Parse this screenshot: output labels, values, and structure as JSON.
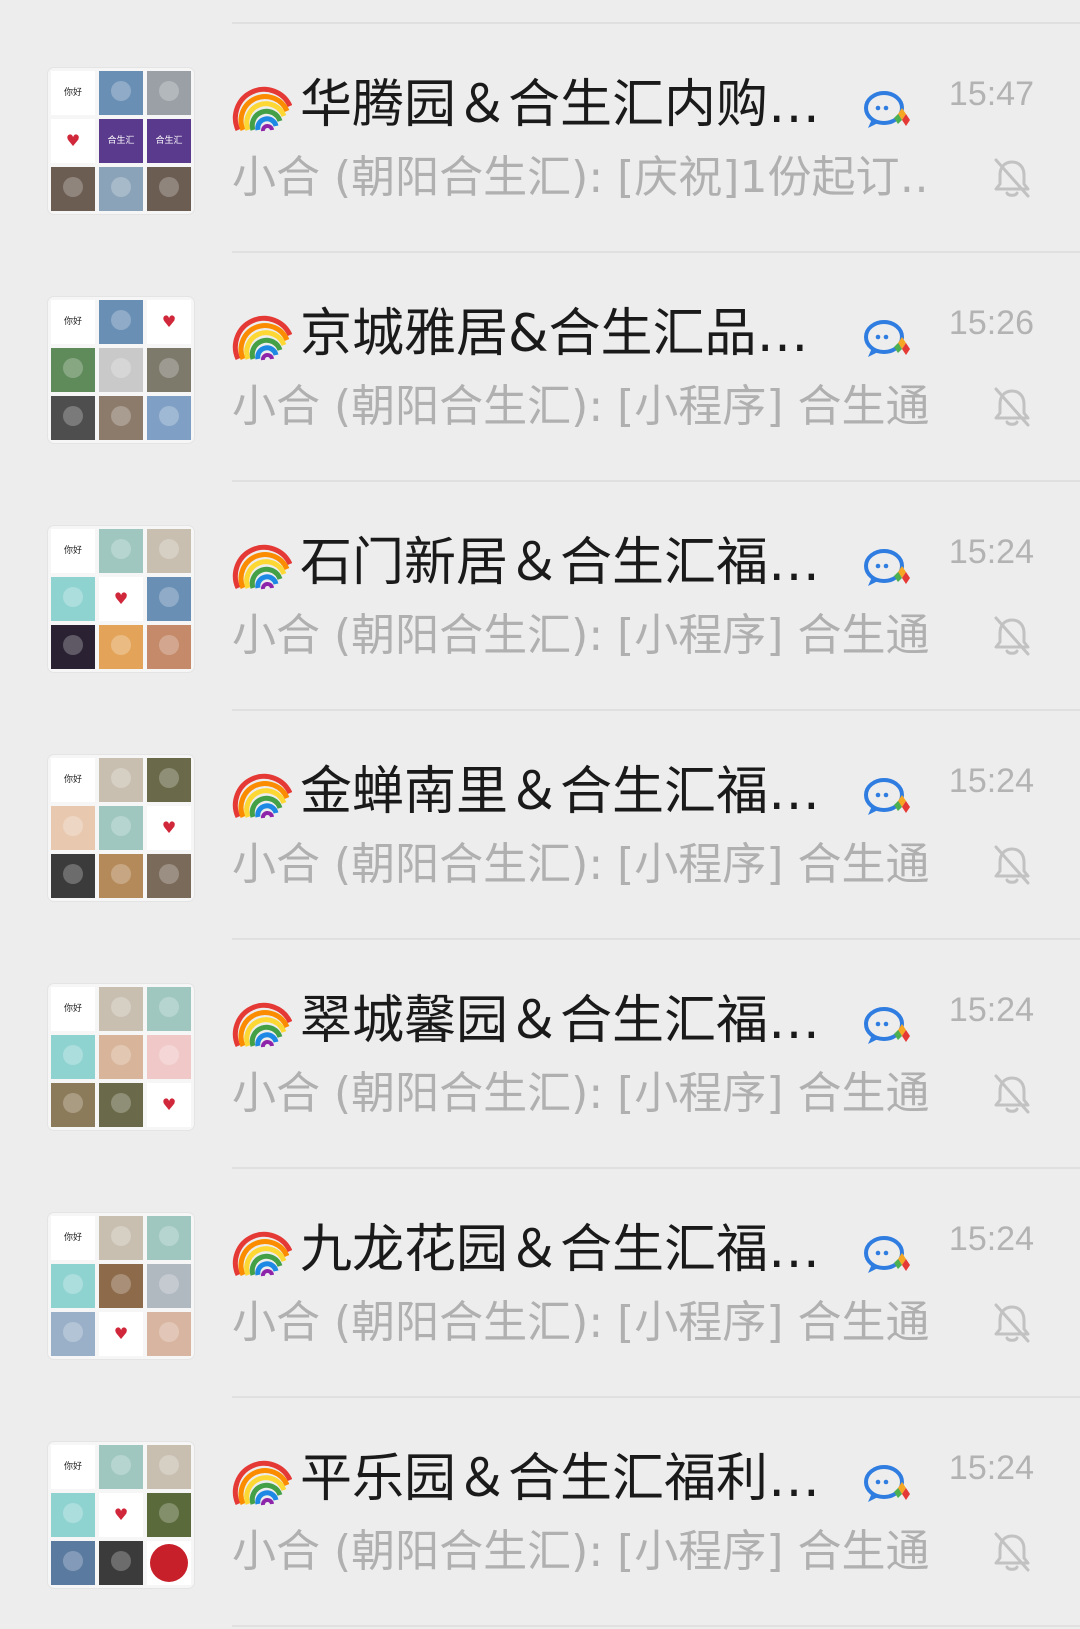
{
  "chats": [
    {
      "title": "华腾园＆合生汇内购…",
      "time": "15:47",
      "preview": "小合 (朝阳合生汇): [庆祝]1份起订…",
      "avatar": [
        "text:你好\n小合",
        "photo:#6a8fb5",
        "photo:#9aa0a6",
        "heart",
        "brand:合生汇",
        "brand:合生汇",
        "photo:#6b5d52",
        "photo:#8aa3b8",
        "photo:#6b5d52"
      ]
    },
    {
      "title": "京城雅居&合生汇品…",
      "time": "15:26",
      "preview": "小合 (朝阳合生汇): [小程序] 合生通",
      "avatar": [
        "text:你好\n小合",
        "photo:#6a8fb5",
        "heart",
        "photo:#5f8a5a",
        "photo:#c9c9c9",
        "photo:#7d7a6c",
        "photo:#4e4e4e",
        "photo:#8c7b6b",
        "photo:#7fa0c4"
      ]
    },
    {
      "title": "石门新居＆合生汇福…",
      "time": "15:24",
      "preview": "小合 (朝阳合生汇): [小程序] 合生通",
      "avatar": [
        "text:你好\n小合",
        "photo:#9fc7c0",
        "photo:#c8bfb0",
        "photo:#8fd3d1",
        "heart",
        "photo:#6a8fb5",
        "photo:#2a2233",
        "photo:#e3a45a",
        "photo:#c48a6a"
      ]
    },
    {
      "title": "金蝉南里＆合生汇福…",
      "time": "15:24",
      "preview": "小合 (朝阳合生汇): [小程序] 合生通",
      "avatar": [
        "text:你好\n小合",
        "photo:#c8bfb0",
        "photo:#6a6a4a",
        "photo:#e8c9b0",
        "photo:#9fc7c0",
        "heart",
        "photo:#3b3b3b",
        "photo:#b58a5a",
        "photo:#7a6a5a"
      ]
    },
    {
      "title": "翠城馨园＆合生汇福…",
      "time": "15:24",
      "preview": "小合 (朝阳合生汇): [小程序] 合生通",
      "avatar": [
        "text:你好\n小合",
        "photo:#c8bfb0",
        "photo:#9fc7c0",
        "photo:#8fd3d1",
        "photo:#d8b59a",
        "photo:#f0c8c8",
        "photo:#8c7b5a",
        "photo:#6a6a4a",
        "heart"
      ]
    },
    {
      "title": "九龙花园＆合生汇福…",
      "time": "15:24",
      "preview": "小合 (朝阳合生汇): [小程序] 合生通",
      "avatar": [
        "text:你好\n小合",
        "photo:#c8bfb0",
        "photo:#9fc7c0",
        "photo:#8fd3d1",
        "photo:#8c6a4a",
        "photo:#b0b8c0",
        "photo:#9ab0c8",
        "heart",
        "photo:#d8b5a0"
      ]
    },
    {
      "title": "平乐园＆合生汇福利…",
      "time": "15:24",
      "preview": "小合 (朝阳合生汇): [小程序] 合生通",
      "avatar": [
        "text:你好\n小合",
        "photo:#9fc7c0",
        "photo:#c8bfb0",
        "photo:#8fd3d1",
        "heart",
        "photo:#5a6a3a",
        "photo:#5a7aa0",
        "photo:#3b3b3b",
        "seal:#c8202a"
      ]
    }
  ],
  "icons": {
    "group_prefix": "rainbow-icon",
    "chat_bubble": "chat-bubble-icon",
    "mute": "mute-bell-icon"
  },
  "colors": {
    "background": "#ededed",
    "title": "#1a1a1a",
    "muted_text": "#b0b0b0",
    "bubble_blue": "#2f7de1"
  }
}
